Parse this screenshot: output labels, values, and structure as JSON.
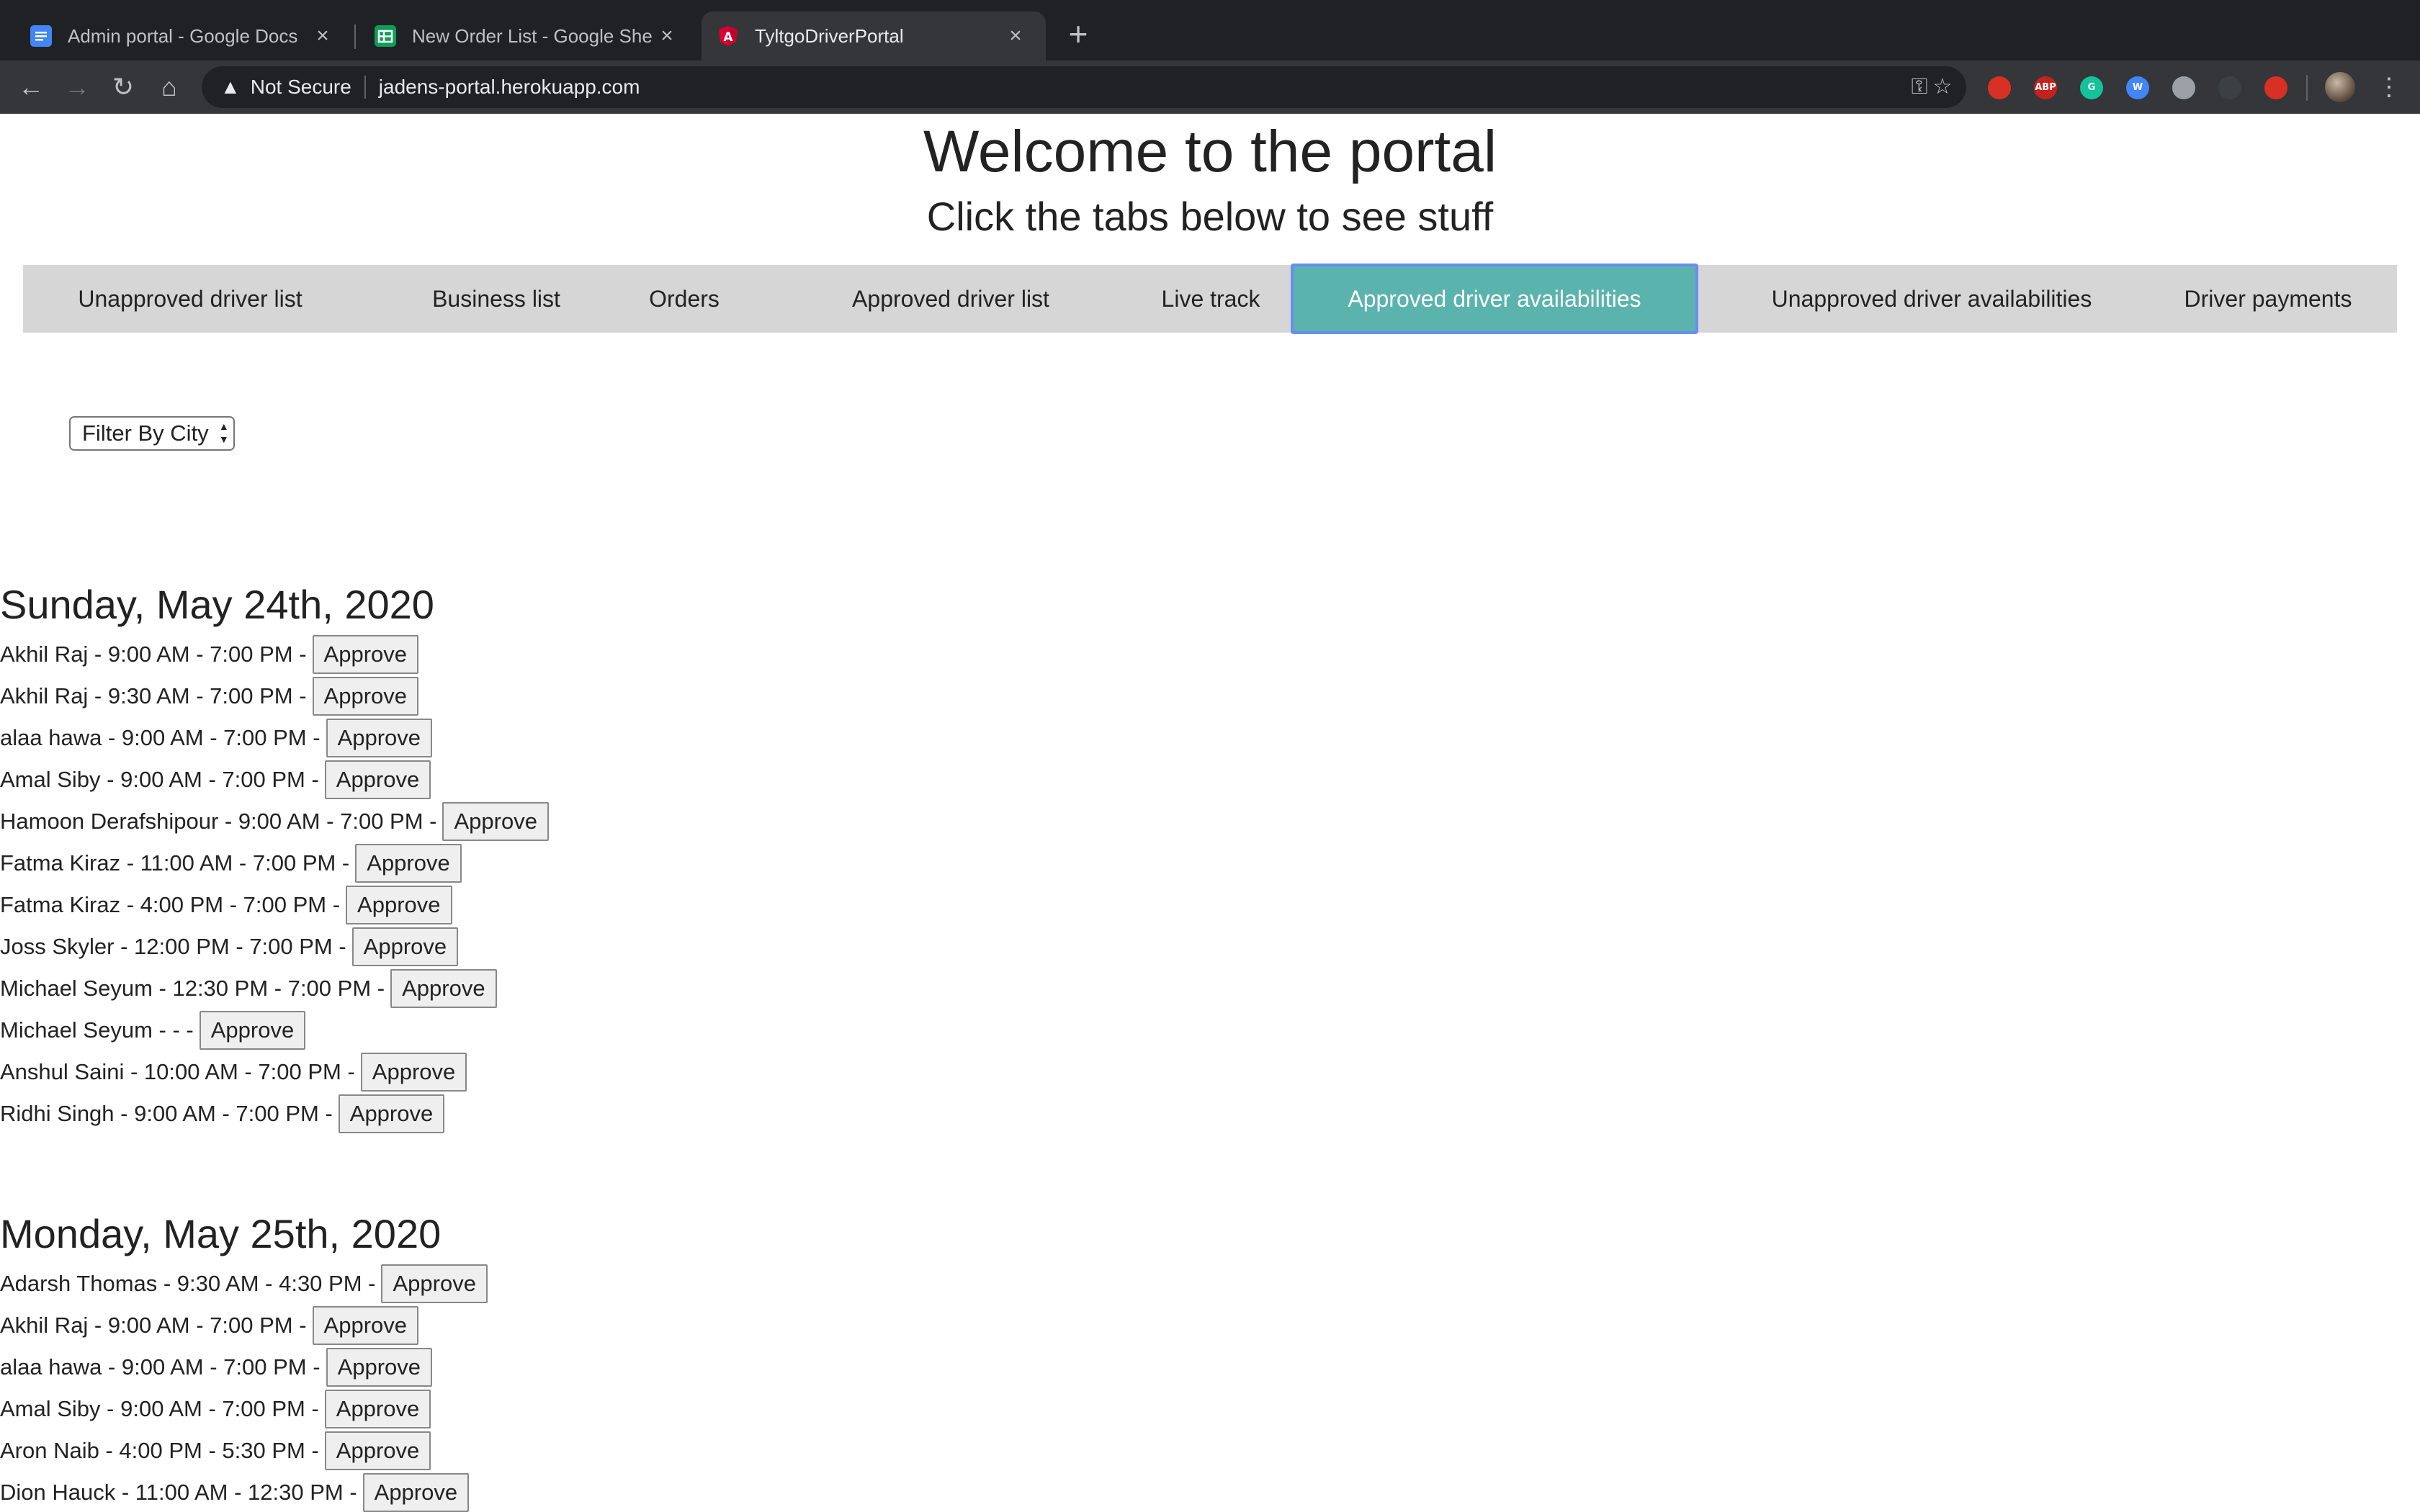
{
  "browser": {
    "tabs": [
      {
        "title": "Admin portal - Google Docs",
        "icon": "google-docs-icon",
        "active": false
      },
      {
        "title": "New Order List - Google Sheets",
        "icon": "google-sheets-icon",
        "active": false
      },
      {
        "title": "TyltgoDriverPortal",
        "icon": "angular-icon",
        "active": true
      }
    ],
    "security_label": "Not Secure",
    "url": "jadens-portal.herokuapp.com",
    "extensions": [
      {
        "name": "stop-extension-icon",
        "label": "",
        "color": "#d93025"
      },
      {
        "name": "adblock-extension-icon",
        "label": "ABP",
        "color": "#c5221f"
      },
      {
        "name": "grammarly-extension-icon",
        "label": "G",
        "color": "#15c39a"
      },
      {
        "name": "w-extension-icon",
        "label": "W",
        "color": "#4285f4"
      },
      {
        "name": "puzzle-extension-icon",
        "label": "",
        "color": "#9aa0a6"
      },
      {
        "name": "media-extension-icon",
        "label": "",
        "color": "#3c4043"
      },
      {
        "name": "sync-extension-icon",
        "label": "",
        "color": "#d93025"
      }
    ]
  },
  "page": {
    "title": "Welcome to the portal",
    "subtitle": "Click the tabs below to see stuff",
    "tabs": [
      {
        "label": "Unapproved driver list"
      },
      {
        "label": "Business list"
      },
      {
        "label": "Orders"
      },
      {
        "label": "Approved driver list"
      },
      {
        "label": "Live track"
      },
      {
        "label": "Approved driver availabilities"
      },
      {
        "label": "Unapproved driver availabilities"
      },
      {
        "label": "Driver payments"
      }
    ],
    "active_tab": "Approved driver availabilities",
    "accent_color": "#5bb3ad",
    "filter": {
      "label": "Filter By City"
    },
    "approve_label": "Approve",
    "days": [
      {
        "title": "Sunday, May 24th, 2020",
        "entries": [
          "Akhil Raj - 9:00 AM - 7:00 PM -",
          "Akhil Raj - 9:30 AM - 7:00 PM -",
          "alaa hawa - 9:00 AM - 7:00 PM -",
          "Amal Siby - 9:00 AM - 7:00 PM -",
          "Hamoon Derafshipour - 9:00 AM - 7:00 PM -",
          "Fatma Kiraz - 11:00 AM - 7:00 PM -",
          "Fatma Kiraz - 4:00 PM - 7:00 PM -",
          "Joss Skyler - 12:00 PM - 7:00 PM -",
          "Michael Seyum - 12:30 PM - 7:00 PM -",
          "Michael Seyum - - -",
          "Anshul Saini - 10:00 AM - 7:00 PM -",
          "Ridhi Singh - 9:00 AM - 7:00 PM -"
        ]
      },
      {
        "title": "Monday, May 25th, 2020",
        "entries": [
          "Adarsh Thomas - 9:30 AM - 4:30 PM -",
          "Akhil Raj - 9:00 AM - 7:00 PM -",
          "alaa hawa - 9:00 AM - 7:00 PM -",
          "Amal Siby - 9:00 AM - 7:00 PM -",
          "Aron Naib - 4:00 PM - 5:30 PM -",
          "Dion Hauck - 11:00 AM - 12:30 PM -"
        ]
      }
    ]
  }
}
